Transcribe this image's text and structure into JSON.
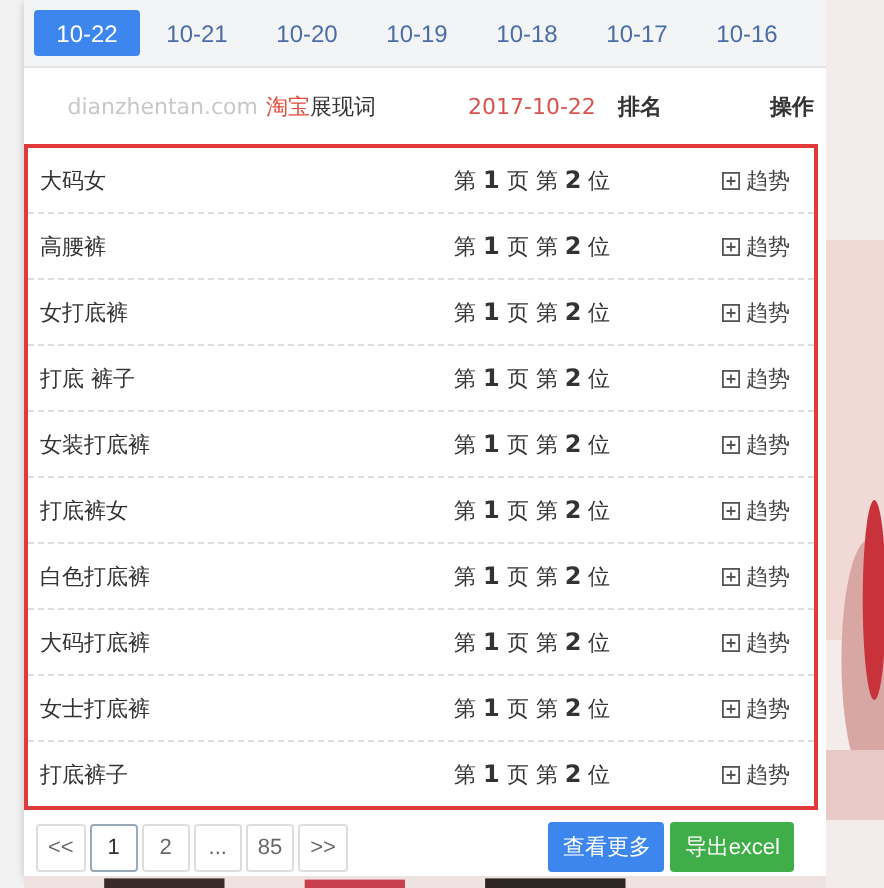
{
  "date_tabs": [
    {
      "label": "10-22",
      "selected": true
    },
    {
      "label": "10-21",
      "selected": false
    },
    {
      "label": "10-20",
      "selected": false
    },
    {
      "label": "10-19",
      "selected": false
    },
    {
      "label": "10-18",
      "selected": false
    },
    {
      "label": "10-17",
      "selected": false
    },
    {
      "label": "10-16",
      "selected": false
    }
  ],
  "header": {
    "site": "dianzhentan.com",
    "platform": "淘宝",
    "title": "展现词",
    "date": "2017-10-22",
    "columns": [
      "排名",
      "操作"
    ]
  },
  "rows": [
    {
      "keyword": "大码女",
      "rank": "第 **1** 页 第 **2** 位",
      "action": "趋势"
    },
    {
      "keyword": "高腰裤",
      "rank": "第 **1** 页 第 **2** 位",
      "action": "趋势"
    },
    {
      "keyword": "女打底裤",
      "rank": "第 **1** 页 第 **2** 位",
      "action": "趋势"
    },
    {
      "keyword": "打底 裤子",
      "rank": "第 **1** 页 第 **2** 位",
      "action": "趋势"
    },
    {
      "keyword": "女装打底裤",
      "rank": "第 **1** 页 第 **2** 位",
      "action": "趋势"
    },
    {
      "keyword": "打底裤女",
      "rank": "第 **1** 页 第 **2** 位",
      "action": "趋势"
    },
    {
      "keyword": "白色打底裤",
      "rank": "第 **1** 页 第 **2** 位",
      "action": "趋势"
    },
    {
      "keyword": "大码打底裤",
      "rank": "第 **1** 页 第 **2** 位",
      "action": "趋势"
    },
    {
      "keyword": "女士打底裤",
      "rank": "第 **1** 页 第 **2** 位",
      "action": "趋势"
    },
    {
      "keyword": "打底裤子",
      "rank": "第 **1** 页 第 **2** 位",
      "action": "趋势"
    }
  ],
  "pagination": [
    {
      "label": "<<",
      "selected": false
    },
    {
      "label": "1",
      "selected": true
    },
    {
      "label": "2",
      "selected": false
    },
    {
      "label": "...",
      "selected": false
    },
    {
      "label": "85",
      "selected": false
    },
    {
      "label": ">>",
      "selected": false
    }
  ],
  "buttons": [
    {
      "label": "查看更多",
      "kind": "primary"
    },
    {
      "label": "导出excel",
      "kind": "success"
    }
  ]
}
